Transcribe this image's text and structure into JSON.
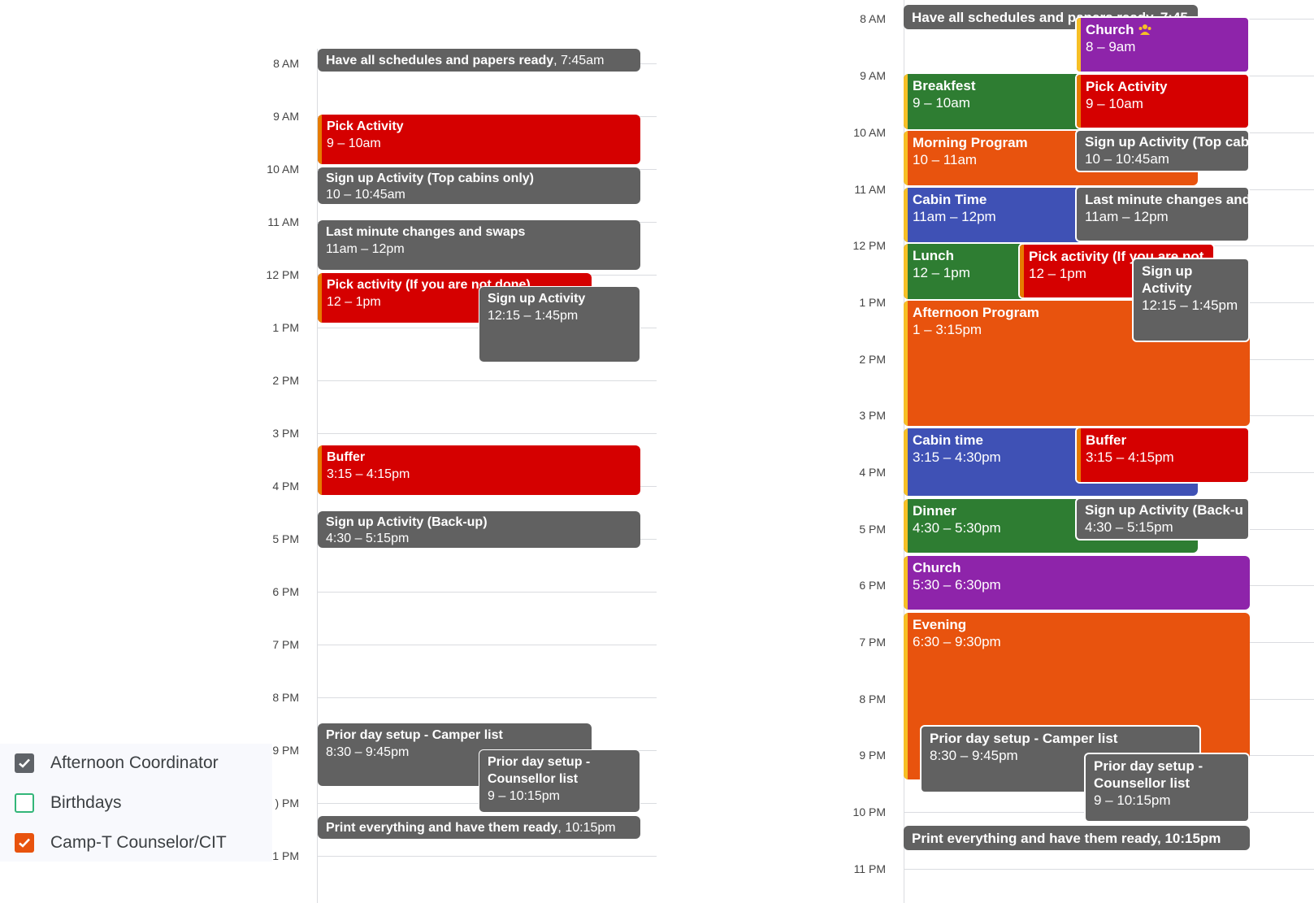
{
  "colors": {
    "gray": "#616161",
    "red": "#d50000",
    "orange": "#e8530e",
    "green": "#2e7d32",
    "blue": "#3f51b5",
    "purple": "#8e24aa",
    "stripe_orange": "#e67c00",
    "stripe_yellow": "#f6bf26",
    "stripe_gray": "#9e9e9e"
  },
  "left": {
    "hours": [
      "8 AM",
      "9 AM",
      "10 AM",
      "11 AM",
      "12 PM",
      "1 PM",
      "2 PM",
      "3 PM",
      "4 PM",
      "5 PM",
      "6 PM",
      "7 PM",
      "8 PM",
      "9 PM",
      ") PM",
      ".1 PM"
    ],
    "events": {
      "schedules": {
        "title": "Have all schedules and papers ready",
        "time": ", 7:45am"
      },
      "pick": {
        "title": "Pick Activity",
        "time": "9 – 10am"
      },
      "signup_top": {
        "title": "Sign up Activity (Top cabins only)",
        "time": "10 – 10:45am"
      },
      "last_minute": {
        "title": "Last minute changes and swaps",
        "time": "11am – 12pm"
      },
      "pick_not_done": {
        "title": "Pick activity (If you are not done)",
        "time": "12 – 1pm"
      },
      "signup": {
        "title": "Sign up Activity",
        "time": "12:15 – 1:45pm"
      },
      "buffer": {
        "title": "Buffer",
        "time": "3:15 – 4:15pm"
      },
      "signup_backup": {
        "title": "Sign up Activity (Back-up)",
        "time": "4:30 – 5:15pm"
      },
      "camper_list": {
        "title": "Prior day setup - Camper list",
        "time": "8:30 – 9:45pm"
      },
      "counsellor_list": {
        "title": "Prior day setup - Counsellor list",
        "time": "9 – 10:15pm"
      },
      "print": {
        "title": "Print everything and have them ready",
        "time": ", 10:15pm"
      }
    }
  },
  "legend": {
    "items": [
      {
        "label": "Afternoon Coordinator",
        "color": "#5f6368",
        "checked": true
      },
      {
        "label": "Birthdays",
        "color": "#33b679",
        "checked": false
      },
      {
        "label": "Camp-T Counselor/CIT",
        "color": "#e8530e",
        "checked": true
      }
    ]
  },
  "right": {
    "hours": [
      "8 AM",
      "9 AM",
      "10 AM",
      "11 AM",
      "12 PM",
      "1 PM",
      "2 PM",
      "3 PM",
      "4 PM",
      "5 PM",
      "6 PM",
      "7 PM",
      "8 PM",
      "9 PM",
      "10 PM",
      "11 PM"
    ],
    "events": {
      "schedules": {
        "title": "Have all schedules and papers ready, 7:45"
      },
      "church_am": {
        "title": "Church",
        "time": "8 – 9am",
        "icon": "people-icon"
      },
      "breakfast": {
        "title": "Breakfest",
        "time": "9 – 10am"
      },
      "pick": {
        "title": "Pick Activity",
        "time": "9 – 10am"
      },
      "morning": {
        "title": "Morning Program",
        "time": "10 – 11am"
      },
      "signup_top": {
        "title": "Sign up Activity (Top cab",
        "time": "10 – 10:45am"
      },
      "cabin_time": {
        "title": "Cabin Time",
        "time": "11am – 12pm"
      },
      "last_minute": {
        "title": "Last minute changes and",
        "time": "11am – 12pm"
      },
      "lunch": {
        "title": "Lunch",
        "time": "12 – 1pm"
      },
      "pick_if": {
        "title": "Pick activity (If you are not",
        "time": "12 – 1pm"
      },
      "signup": {
        "title": "Sign up Activity",
        "time": "12:15 – 1:45pm"
      },
      "afternoon": {
        "title": "Afternoon Program",
        "time": "1 – 3:15pm"
      },
      "cabin_time2": {
        "title": "Cabin time",
        "time": "3:15 – 4:30pm"
      },
      "buffer": {
        "title": "Buffer",
        "time": "3:15 – 4:15pm"
      },
      "dinner": {
        "title": "Dinner",
        "time": "4:30 – 5:30pm"
      },
      "signup_backup": {
        "title": "Sign up Activity (Back-u",
        "time": "4:30 – 5:15pm"
      },
      "church_pm": {
        "title": "Church",
        "time": "5:30 – 6:30pm"
      },
      "evening": {
        "title": "Evening",
        "time": "6:30 – 9:30pm"
      },
      "camper_list": {
        "title": "Prior day setup - Camper list",
        "time": "8:30 – 9:45pm"
      },
      "counsellor_list": {
        "title": "Prior day setup - Counsellor list",
        "time": "9 – 10:15pm"
      },
      "print": {
        "title": "Print everything and have them ready, 10:15pm"
      }
    }
  }
}
